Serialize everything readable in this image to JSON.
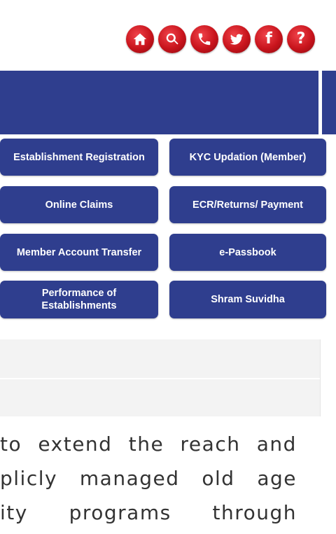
{
  "header": {
    "icons": [
      {
        "name": "home-icon",
        "glyph": ""
      },
      {
        "name": "search-icon",
        "glyph": ""
      },
      {
        "name": "phone-icon",
        "glyph": ""
      },
      {
        "name": "twitter-icon",
        "glyph": ""
      },
      {
        "name": "facebook-icon",
        "glyph": "f"
      },
      {
        "name": "help-icon",
        "glyph": "?"
      }
    ],
    "brand_color": "#c8141c"
  },
  "banner": {
    "color": "#2f3e8e"
  },
  "quick_links": {
    "establishment_registration": "Establishment Registration",
    "kyc_updation": "KYC Updation (Member)",
    "online_claims": "Online Claims",
    "ecr_returns_payment": "ECR/Returns/ Payment",
    "member_account_transfer": "Member Account Transfer",
    "e_passbook": "e-Passbook",
    "performance_line1": "Performance of",
    "performance_line2": "Establishments",
    "shram_suvidha": "Shram Suvidha",
    "button_color": "#2f3e8e"
  },
  "body": {
    "line1": [
      "to",
      "extend",
      "the",
      "reach",
      "and"
    ],
    "line2": [
      "plicly",
      "managed",
      "old",
      "age"
    ],
    "line3": [
      "ity",
      "programs",
      "through"
    ]
  }
}
